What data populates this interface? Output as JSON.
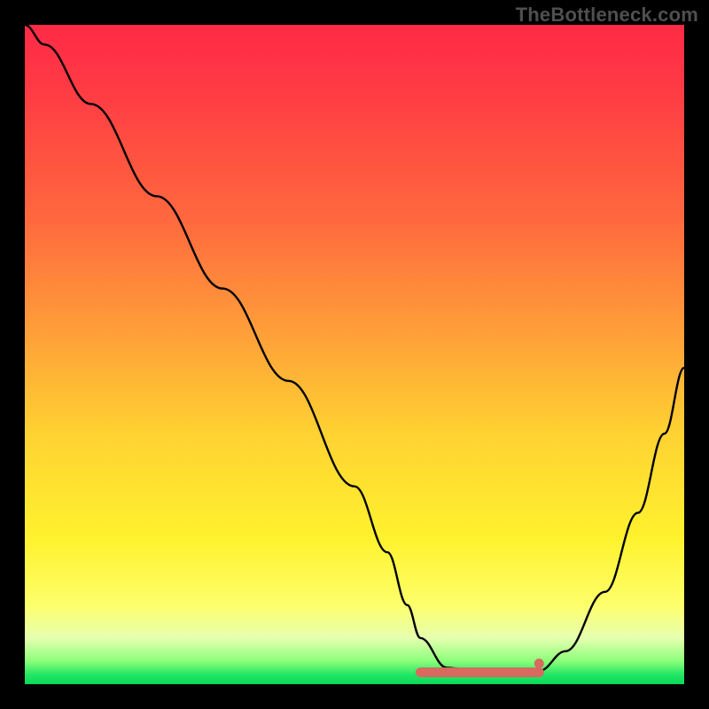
{
  "watermark": "TheBottleneck.com",
  "chart_data": {
    "type": "line",
    "title": "",
    "xlabel": "",
    "ylabel": "",
    "xlim": [
      0,
      1
    ],
    "ylim": [
      0,
      1
    ],
    "grid": false,
    "legend": false,
    "series": [
      {
        "name": "curve",
        "x": [
          0.0,
          0.03,
          0.1,
          0.2,
          0.3,
          0.4,
          0.5,
          0.55,
          0.58,
          0.6,
          0.64,
          0.7,
          0.75,
          0.78,
          0.82,
          0.88,
          0.93,
          0.97,
          1.0
        ],
        "values": [
          1.0,
          0.97,
          0.88,
          0.74,
          0.6,
          0.46,
          0.3,
          0.2,
          0.12,
          0.07,
          0.025,
          0.015,
          0.015,
          0.02,
          0.05,
          0.14,
          0.26,
          0.38,
          0.48
        ]
      }
    ],
    "annotations": {
      "bottom_markers_x": [
        0.6,
        0.63,
        0.66,
        0.69,
        0.72,
        0.75,
        0.78
      ],
      "bottom_markers_y": 0.018,
      "marker_color": "#d86a5f",
      "background_gradient": {
        "top": "#ff2a46",
        "mid": "#ffd232",
        "bottom": "#0bd85a"
      }
    }
  }
}
